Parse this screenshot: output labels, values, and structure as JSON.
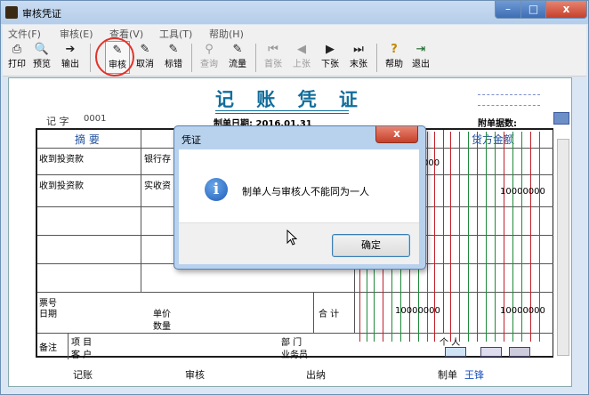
{
  "window": {
    "title": "审核凭证",
    "min": "–",
    "max": "□",
    "close": "x"
  },
  "menu": [
    "文件(F)",
    "审核(E)",
    "查看(V)",
    "工具(T)",
    "帮助(H)"
  ],
  "toolbar": [
    {
      "label": "打印",
      "icon": "printer-icon",
      "glyph": "⎙",
      "enabled": true
    },
    {
      "label": "预览",
      "icon": "preview-icon",
      "glyph": "🔍",
      "enabled": true
    },
    {
      "label": "输出",
      "icon": "export-icon",
      "glyph": "➔",
      "enabled": true
    },
    {
      "label": "审核",
      "icon": "audit-pen-icon",
      "glyph": "✎",
      "enabled": true
    },
    {
      "label": "取消",
      "icon": "cancel-pen-icon",
      "glyph": "✎",
      "enabled": true
    },
    {
      "label": "标错",
      "icon": "mark-error-icon",
      "glyph": "✎",
      "enabled": true
    },
    {
      "label": "查询",
      "icon": "binoculars-icon",
      "glyph": "⚲",
      "enabled": false
    },
    {
      "label": "流量",
      "icon": "flow-pen-icon",
      "glyph": "✎",
      "enabled": true
    },
    {
      "label": "首张",
      "icon": "first-icon",
      "glyph": "⏮",
      "enabled": false
    },
    {
      "label": "上张",
      "icon": "prev-icon",
      "glyph": "◀",
      "enabled": false
    },
    {
      "label": "下张",
      "icon": "next-icon",
      "glyph": "▶",
      "enabled": true
    },
    {
      "label": "末张",
      "icon": "last-icon",
      "glyph": "⏭",
      "enabled": true
    },
    {
      "label": "帮助",
      "icon": "help-icon",
      "glyph": "?",
      "enabled": true
    },
    {
      "label": "退出",
      "icon": "exit-icon",
      "glyph": "⇥",
      "enabled": true
    }
  ],
  "voucher": {
    "title": "记 账 凭 证",
    "type_label": "记 字",
    "number": "0001",
    "date": "制单日期: 2016.01.31",
    "attachments": "附单据数:",
    "headers": {
      "summary": "摘 要",
      "credit": "贷方金额"
    },
    "rows": [
      {
        "summary": "收到投资款",
        "account": "银行存",
        "debit": "000",
        "credit": ""
      },
      {
        "summary": "收到投资款",
        "account": "实收资",
        "debit": "",
        "credit": "10000000"
      }
    ],
    "ticket_label": "票号",
    "date_label": "日期",
    "unit_price_label": "单价",
    "quantity_label": "数量",
    "total_label": "合 计",
    "total_debit": "10000000",
    "total_credit": "10000000",
    "note_label": "备注",
    "item_label": "项 目",
    "dept_label": "部 门",
    "person_label": "个 人",
    "customer_label": "客 户",
    "salesman_label": "业务员",
    "signatures": {
      "bookkeeper": "记账",
      "auditor": "审核",
      "cashier": "出纳",
      "preparer": "制单",
      "preparer_name": "王锋"
    }
  },
  "dialog": {
    "title": "凭证",
    "close": "x",
    "message": "制单人与审核人不能同为一人",
    "ok": "确定"
  },
  "colors": {
    "accent": "#116e9c",
    "red_lines": "#c0202a",
    "green_lines": "#1e8a3a"
  }
}
